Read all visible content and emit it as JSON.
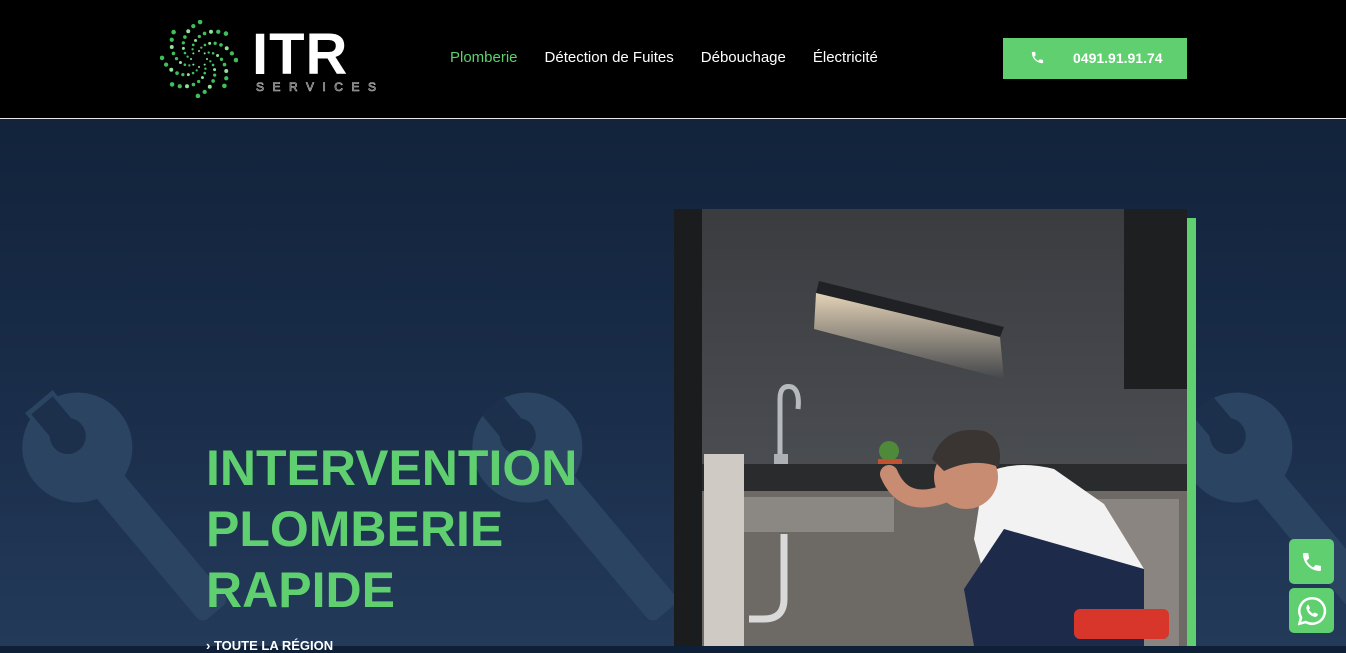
{
  "brand": {
    "name": "ITR",
    "subtitle": "SERVICES"
  },
  "nav": {
    "items": [
      {
        "label": "Plomberie",
        "active": true
      },
      {
        "label": "Détection de Fuites",
        "active": false
      },
      {
        "label": "Débouchage",
        "active": false
      },
      {
        "label": "Électricité",
        "active": false
      }
    ]
  },
  "cta": {
    "phone": "0491.91.91.74",
    "icon": "phone-icon"
  },
  "hero": {
    "title_lines": [
      "INTERVENTION",
      "PLOMBERIE",
      "RAPIDE"
    ],
    "tagline": "TOUTE LA RÉGION",
    "image_icon": "plumber-photo"
  },
  "floating": {
    "call_icon": "phone-icon",
    "whatsapp_icon": "whatsapp-icon"
  },
  "colors": {
    "accent": "#5fcf6f",
    "header_bg": "#000000",
    "hero_bg": "#182b47"
  }
}
